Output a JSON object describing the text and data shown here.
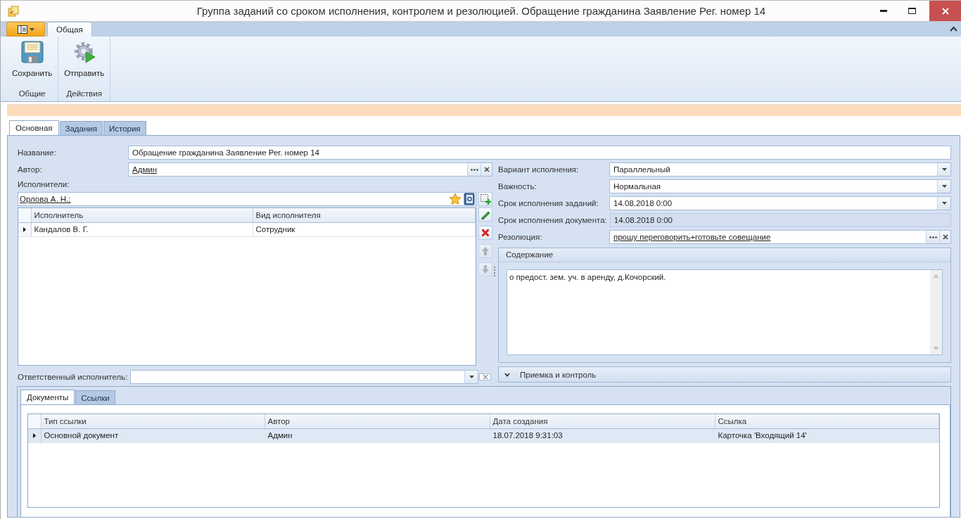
{
  "window": {
    "title": "Группа заданий со сроком исполнения, контролем и резолюцией. Обращение гражданина Заявление Рег. номер 14"
  },
  "ribbon": {
    "tabs": [
      {
        "label": "Общая",
        "selected": true
      }
    ],
    "groups": [
      {
        "label": "Общие",
        "buttons": [
          {
            "label": "Сохранить",
            "kind": "save"
          }
        ]
      },
      {
        "label": "Действия",
        "buttons": [
          {
            "label": "Отправить",
            "kind": "send"
          }
        ]
      }
    ]
  },
  "form_tabs": [
    {
      "label": "Основная",
      "selected": true
    },
    {
      "label": "Задания",
      "selected": false
    },
    {
      "label": "История",
      "selected": false
    }
  ],
  "name_field": {
    "label": "Название:",
    "value": "Обращение гражданина Заявление Рег. номер 14",
    "kind": "text"
  },
  "author_field": {
    "label": "Автор:",
    "value": "Админ",
    "kind": "lookup"
  },
  "executors": {
    "label": "Исполнители:",
    "value": "Орлова А. Н.;",
    "columns": [
      "Исполнитель",
      "Вид исполнителя"
    ],
    "rows": [
      {
        "cells": [
          "Кандалов В. Г.",
          "Сотрудник"
        ],
        "selected": true
      }
    ]
  },
  "responsible_field": {
    "label": "Ответственный исполнитель:",
    "kind": "combo_clear"
  },
  "right_fields": [
    {
      "label": "Вариант исполнения:",
      "value": "Параллельный",
      "kind": "dropdown"
    },
    {
      "label": "Важность:",
      "value": "Нормальная",
      "kind": "dropdown"
    },
    {
      "label": "Срок исполнения заданий:",
      "value": "14.08.2018 0:00",
      "kind": "dropdown"
    },
    {
      "label": "Срок исполнения документа:",
      "value": "14.08.2018 0:00",
      "kind": "readonly"
    },
    {
      "label": "Резолюция:",
      "value": "прошу переговорить+готовьте совещание",
      "kind": "lookup"
    }
  ],
  "content": {
    "title": "Содержание",
    "text": "о предост. зем. уч. в аренду, д.Кочорский."
  },
  "acceptance": {
    "title": "Приемка и контроль",
    "expanded": false
  },
  "documents": {
    "tabs": [
      {
        "label": "Документы",
        "selected": true
      },
      {
        "label": "Ссылки",
        "selected": false
      }
    ],
    "columns": [
      "Тип ссылки",
      "Автор",
      "Дата создания",
      "Ссылка"
    ],
    "rows": [
      {
        "cells": [
          "Основной документ",
          "Админ",
          "18.07.2018 9:31:03",
          "Карточка 'Входящий 14'"
        ],
        "selected": true
      }
    ]
  }
}
